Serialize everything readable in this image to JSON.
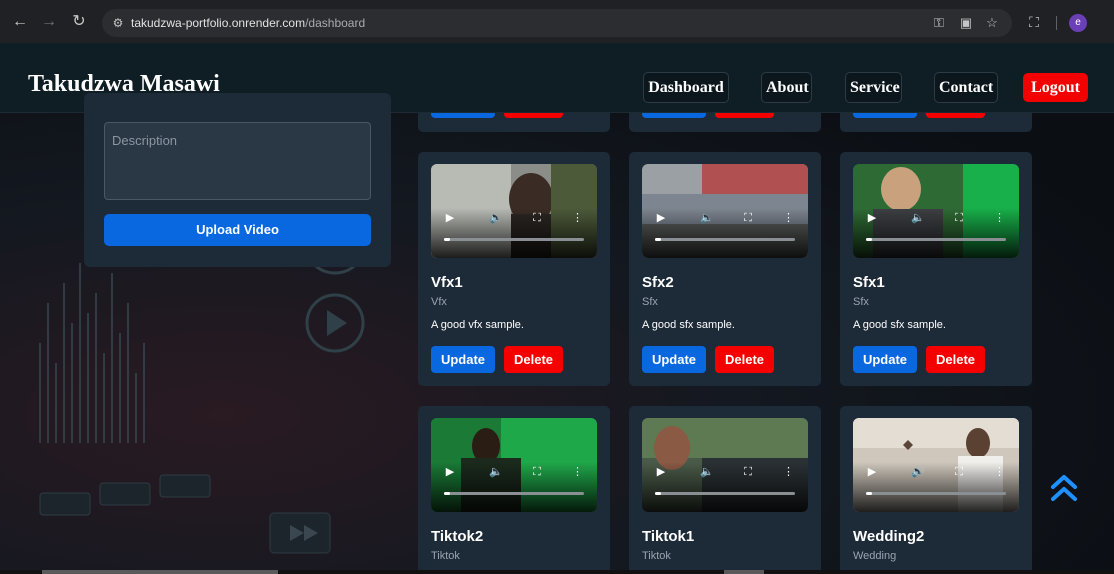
{
  "browser": {
    "url_host": "takudzwa-portfolio.onrender.com",
    "url_path": "/dashboard",
    "profile_initial": "e",
    "icons": [
      "back-icon",
      "forward-icon",
      "reload-icon",
      "site-settings-icon",
      "password-key-icon",
      "install-app-icon",
      "bookmark-star-icon",
      "extensions-icon"
    ]
  },
  "header": {
    "brand": "Takudzwa Masawi",
    "nav": [
      "Dashboard",
      "About",
      "Service",
      "Contact"
    ],
    "logout": "Logout"
  },
  "form": {
    "description_placeholder": "Description",
    "upload_label": "Upload Video"
  },
  "videos": [
    {
      "title": "Vfx1",
      "category": "Vfx",
      "description": "A good vfx sample.",
      "update_label": "Update",
      "delete_label": "Delete"
    },
    {
      "title": "Sfx2",
      "category": "Sfx",
      "description": "A good sfx sample.",
      "update_label": "Update",
      "delete_label": "Delete"
    },
    {
      "title": "Sfx1",
      "category": "Sfx",
      "description": "A good sfx sample.",
      "update_label": "Update",
      "delete_label": "Delete"
    },
    {
      "title": "Tiktok2",
      "category": "Tiktok"
    },
    {
      "title": "Tiktok1",
      "category": "Tiktok"
    },
    {
      "title": "Wedding2",
      "category": "Wedding"
    }
  ],
  "colors": {
    "primary_blue": "#0967e0",
    "danger_red": "#f50000",
    "card_bg": "#1d2a37",
    "scroll_top_accent": "#1e90ff"
  }
}
